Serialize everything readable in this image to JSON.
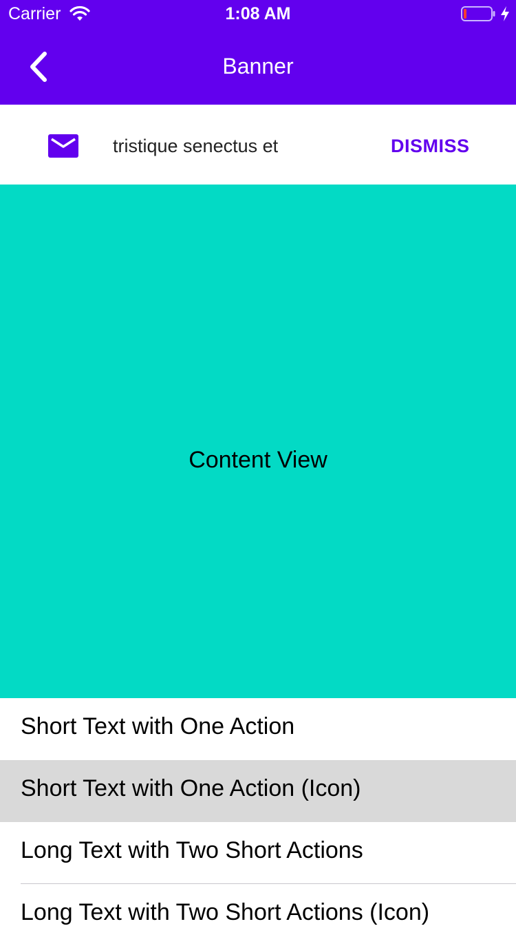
{
  "status_bar": {
    "carrier": "Carrier",
    "time": "1:08 AM",
    "icons": [
      "wifi-icon",
      "battery-icon",
      "charging-bolt-icon"
    ]
  },
  "nav": {
    "title": "Banner",
    "back_icon": "chevron-left-icon"
  },
  "banner": {
    "icon": "mail-icon",
    "text": "tristique senectus et",
    "action_label": "DISMISS"
  },
  "content": {
    "label": "Content View"
  },
  "list": {
    "items": [
      {
        "label": "Short Text with One Action"
      },
      {
        "label": "Short Text with One Action (Icon)",
        "selected": true
      },
      {
        "label": "Long Text with Two Short Actions"
      },
      {
        "label": "Long Text with Two Short Actions (Icon)"
      }
    ]
  },
  "colors": {
    "primary": "#6200EE",
    "secondary": "#03DAC5",
    "selected_row": "#D9D9D9",
    "battery_low": "#FF3B30"
  }
}
